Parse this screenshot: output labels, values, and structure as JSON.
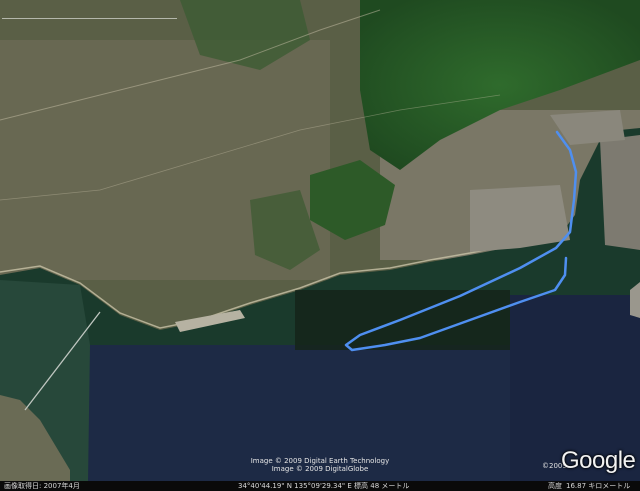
{
  "map": {
    "credits": {
      "line1": "Image © 2009 Digital Earth Technology",
      "line2": "Image © 2009 DigitalGlobe",
      "copyright_year": "©2009"
    },
    "logo_text": "Google",
    "status": {
      "imagery_date": "画像取得日: 2007年4月",
      "coordinates": "34°40'44.19\" N   135°09'29.34\" E   標高   48 メートル",
      "altitude_label": "高度",
      "altitude_value": "16.87 キロメートル"
    },
    "route": {
      "color": "#4f8ff0"
    },
    "icons": [
      "google-logo"
    ]
  }
}
